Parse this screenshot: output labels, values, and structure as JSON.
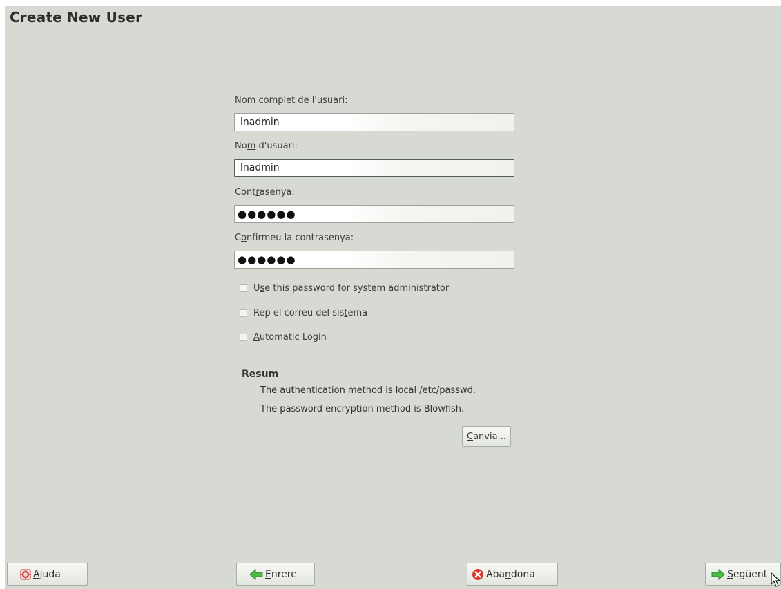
{
  "title": "Create New User",
  "form": {
    "fullname": {
      "label_pre": "Nom com",
      "label_u": "p",
      "label_post": "let de l'usuari:",
      "value": "lnadmin"
    },
    "username": {
      "label_pre": "No",
      "label_u": "m",
      "label_post": " d'usuari:",
      "value": "lnadmin"
    },
    "password": {
      "label_pre": "Cont",
      "label_u": "r",
      "label_post": "asenya:",
      "value": "●●●●●●"
    },
    "confirm": {
      "label_pre": "C",
      "label_u": "o",
      "label_post": "nfirmeu la contrasenya:",
      "value": "●●●●●●"
    }
  },
  "checkboxes": [
    {
      "pre": "U",
      "u": "s",
      "post": "e this password for system administrator",
      "checked": false
    },
    {
      "pre": "Rep el correu del sis",
      "u": "t",
      "post": "ema",
      "checked": false
    },
    {
      "pre": "",
      "u": "A",
      "post": "utomatic Login",
      "checked": false
    }
  ],
  "summary": {
    "heading": "Resum",
    "line1": "The authentication method is local /etc/passwd.",
    "line2": "The password encryption method is Blowfish.",
    "change_u": "C",
    "change_rest": "anvia..."
  },
  "buttons": {
    "help_u": "A",
    "help_rest": "juda",
    "back_u": "E",
    "back_rest": "nrere",
    "abort_pre": "Aba",
    "abort_u": "n",
    "abort_post": "dona",
    "next_u": "S",
    "next_rest": "egüent"
  },
  "colors": {
    "background": "#d6dad3",
    "back_arrow": "#3cae3c",
    "abort": "#d63a2e",
    "help": "#cc3333"
  },
  "icons": [
    "help-icon",
    "back-arrow-icon",
    "abort-icon",
    "next-arrow-icon",
    "mouse-cursor-icon"
  ]
}
